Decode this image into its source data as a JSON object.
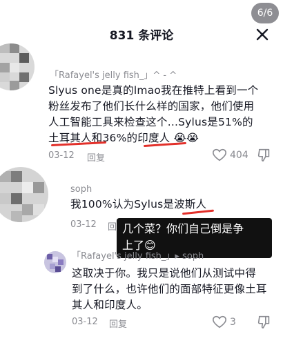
{
  "header": {
    "title": "831 条评论",
    "page_indicator": "6/6",
    "close_icon": "close-icon"
  },
  "comments": [
    {
      "username": "「Rafayel's jelly fish_」^ - ^",
      "text_line1": "Slyus one是真的lmao我在推特上看到一个",
      "text_line2": "粉丝发布了他们长什么样的国家，他们使用",
      "text_line3": "人工智能工具来检查这个...Sylus是51%的",
      "text_line4": "土耳其人和36%的印度人 😭😭",
      "date": "03-12",
      "reply_label": "回复",
      "likes": "404"
    },
    {
      "username": "soph",
      "text_line1": "我100%认为Sylus是波斯人",
      "date": "03-12",
      "reply_label": "回复"
    },
    {
      "username": "「Rafayel's jelly fish_」▸ soph",
      "text_line1": "这取决于你。我只是说他们从测试中得",
      "text_line2": "到了什么，也许他们的面部特征更像土耳",
      "text_line3": "其人和印度人。",
      "date": "03-12",
      "reply_label": "回复",
      "likes": "3"
    }
  ],
  "sticker": {
    "line1": "几个菜？你们自己倒是争",
    "line2": "上了😊"
  },
  "colors": {
    "underline": "#e2302a",
    "secondary_text": "#8a8b91",
    "sticker_bg": "#111111"
  }
}
